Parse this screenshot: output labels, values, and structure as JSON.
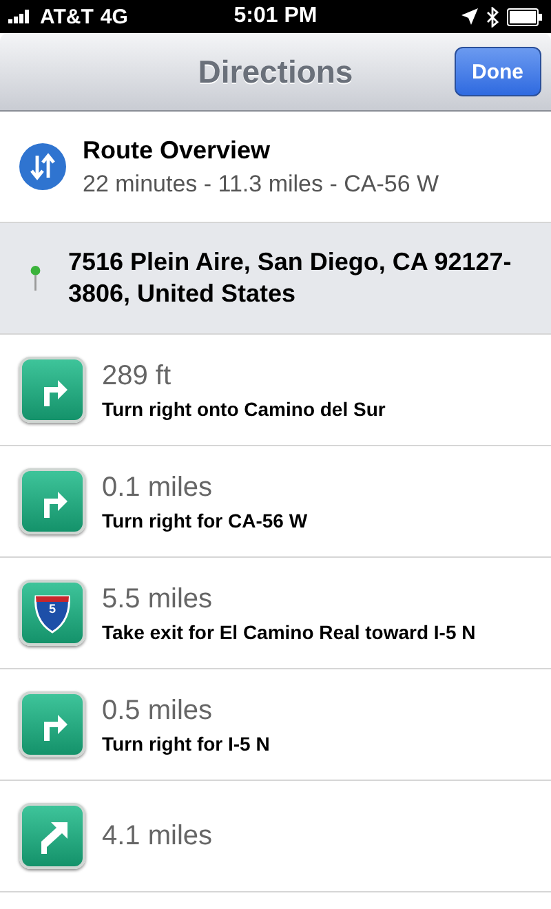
{
  "status_bar": {
    "carrier": "AT&T",
    "network": "4G",
    "time": "5:01 PM"
  },
  "nav_bar": {
    "title": "Directions",
    "done_button": "Done"
  },
  "overview": {
    "title": "Route Overview",
    "summary": "22 minutes - 11.3 miles - CA-56 W"
  },
  "destination": {
    "address": "7516 Plein Aire, San Diego, CA 92127-3806, United States"
  },
  "steps": [
    {
      "kind": "turn-right",
      "distance": "289 ft",
      "instruction": "Turn right onto Camino del Sur"
    },
    {
      "kind": "turn-right",
      "distance": "0.1 miles",
      "instruction": "Turn right for CA-56 W"
    },
    {
      "kind": "interstate",
      "shield": "5",
      "distance": "5.5 miles",
      "instruction": "Take exit for El Camino Real toward I-5 N"
    },
    {
      "kind": "turn-right",
      "distance": "0.5 miles",
      "instruction": "Turn right for I-5 N"
    },
    {
      "kind": "bear-right",
      "distance": "4.1 miles"
    }
  ]
}
